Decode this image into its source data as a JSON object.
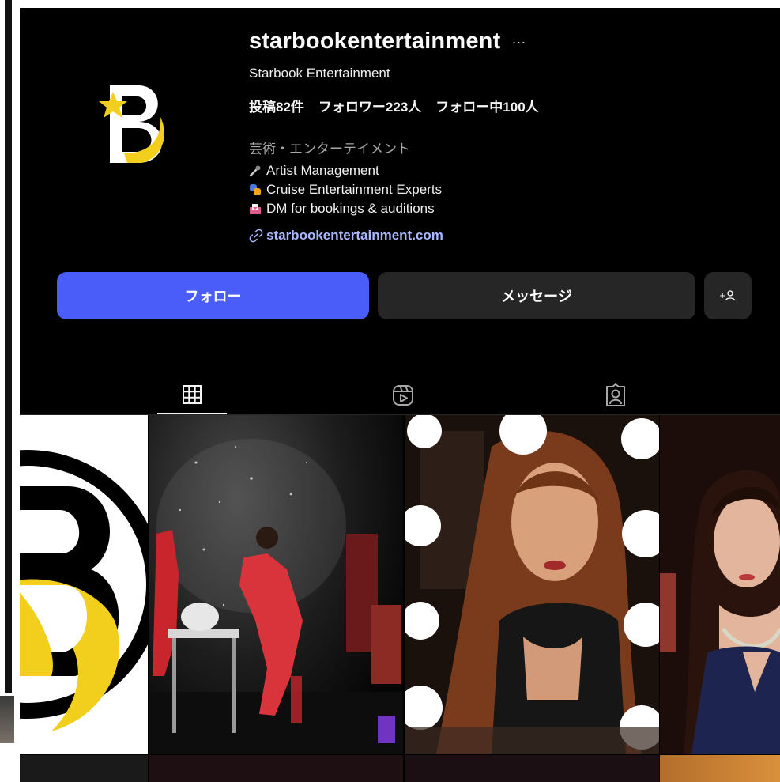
{
  "profile": {
    "username": "starbookentertainment",
    "more_icon": "···",
    "display_name": "Starbook Entertainment",
    "stats": {
      "posts": "投稿82件",
      "followers": "フォロワー223人",
      "following": "フォロー中100人"
    },
    "category": "芸術・エンターテイメント",
    "bio": [
      {
        "icon": "microphone-icon",
        "text": "Artist Management"
      },
      {
        "icon": "theater-masks-icon",
        "text": "Cruise Entertainment Experts"
      },
      {
        "icon": "inbox-icon",
        "text": "DM for bookings & auditions"
      }
    ],
    "link": "starbookentertainment.com"
  },
  "actions": {
    "follow": "フォロー",
    "message": "メッセージ",
    "add_user_icon": "+👤"
  },
  "tabs": [
    {
      "name": "posts",
      "icon": "grid-icon",
      "active": true
    },
    {
      "name": "reels",
      "icon": "reels-icon",
      "active": false
    },
    {
      "name": "tagged",
      "icon": "tagged-icon",
      "active": false
    }
  ],
  "colors": {
    "background": "#000000",
    "follow_button": "#4a5df9",
    "secondary_button": "#262626",
    "link": "#a9b8ff",
    "logo_yellow": "#f2cf1d"
  }
}
